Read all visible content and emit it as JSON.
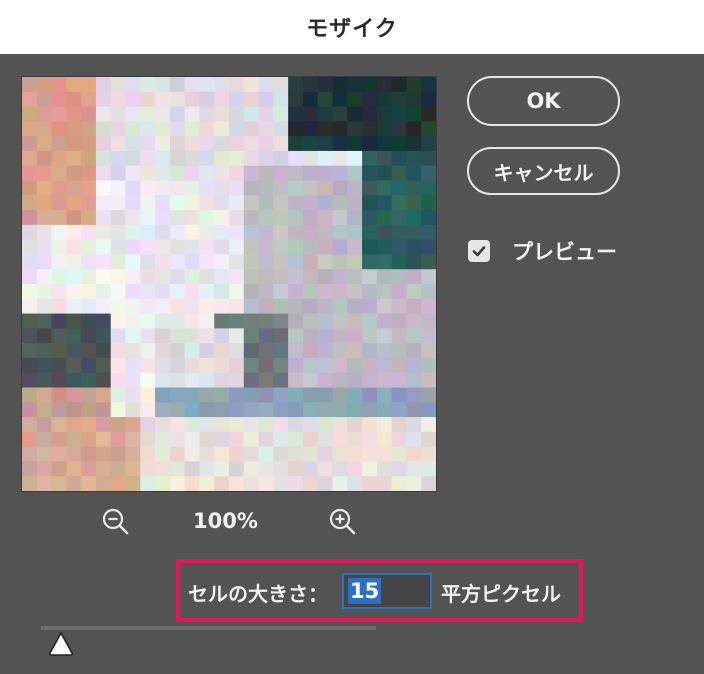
{
  "dialog": {
    "title": "モザイク",
    "buttons": {
      "ok": "OK",
      "cancel": "キャンセル"
    },
    "preview_checkbox": {
      "label": "プレビュー",
      "checked": true
    },
    "zoom": {
      "level": "100%",
      "out_icon": "zoom-out-icon",
      "in_icon": "zoom-in-icon"
    },
    "cell_size": {
      "label": "セルの大きさ：",
      "value": "15",
      "unit": "平方ピクセル"
    },
    "slider": {
      "value": 15
    },
    "colors": {
      "highlight": "#e5175c",
      "accent": "#2e6fc0",
      "background": "#535353"
    }
  }
}
